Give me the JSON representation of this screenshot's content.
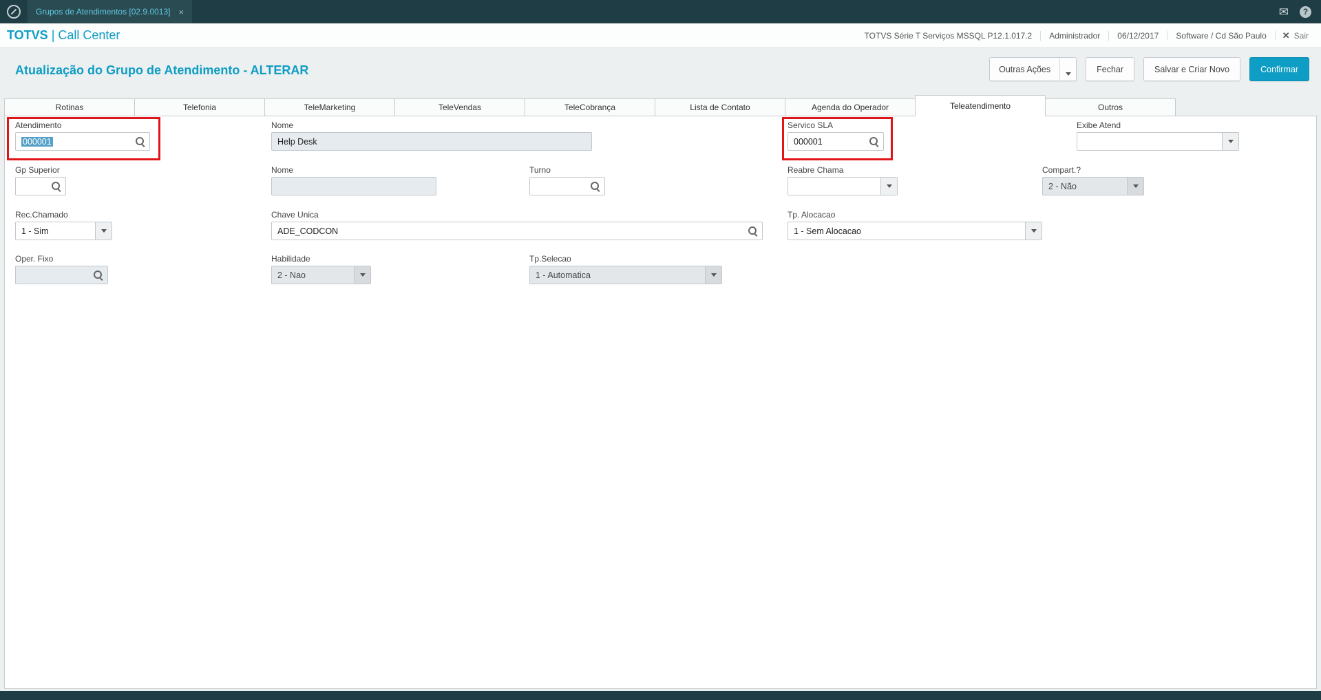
{
  "colors": {
    "accent": "#0e9dc4",
    "topbar_bg": "#1e3d44",
    "annotation_red": "#e01518",
    "readonly_bg": "#e6ebef",
    "selection_bg": "#55a0c8"
  },
  "topbar": {
    "tab_label": "Grupos de Atendimentos [02.9.0013]",
    "tab_close": "×",
    "help_glyph": "?",
    "mail_glyph": "✉"
  },
  "header": {
    "brand_bold": "TOTVS",
    "brand_rest": " | Call Center",
    "items": [
      "TOTVS Série T Serviços MSSQL P12.1.017.2",
      "Administrador",
      "06/12/2017",
      "Software / Cd São Paulo"
    ],
    "logout_x": "✕",
    "logout_label": "Sair"
  },
  "toolbar": {
    "title": "Atualização do Grupo de Atendimento - ALTERAR",
    "buttons": {
      "other_actions": "Outras Ações",
      "close": "Fechar",
      "save_and_new": "Salvar e Criar Novo",
      "confirm": "Confirmar"
    }
  },
  "tabs": [
    "Rotinas",
    "Telefonia",
    "TeleMarketing",
    "TeleVendas",
    "TeleCobrança",
    "Lista de Contato",
    "Agenda do Operador",
    "Teleatendimento",
    "Outros"
  ],
  "active_tab": "Teleatendimento",
  "form": {
    "atendimento": {
      "label": "Atendimento",
      "value": "000001"
    },
    "nome_grupo": {
      "label": "Nome",
      "value": "Help Desk"
    },
    "servico_sla": {
      "label": "Servico SLA",
      "value": "000001"
    },
    "exibe_atend": {
      "label": "Exibe Atend",
      "value": ""
    },
    "gp_superior": {
      "label": "Gp Superior",
      "value": ""
    },
    "nome_superior": {
      "label": "Nome",
      "value": ""
    },
    "turno": {
      "label": "Turno",
      "value": ""
    },
    "reabre_chama": {
      "label": "Reabre Chama",
      "value": ""
    },
    "compart": {
      "label": "Compart.?",
      "value": "2 - Não"
    },
    "rec_chamado": {
      "label": "Rec.Chamado",
      "value": "1 - Sim"
    },
    "chave_unica": {
      "label": "Chave Unica",
      "value": "ADE_CODCON"
    },
    "tp_alocacao": {
      "label": "Tp. Alocacao",
      "value": "1 - Sem Alocacao"
    },
    "oper_fixo": {
      "label": "Oper. Fixo",
      "value": ""
    },
    "habilidade": {
      "label": "Habilidade",
      "value": "2 - Nao"
    },
    "tp_selecao": {
      "label": "Tp.Selecao",
      "value": "1 - Automatica"
    }
  }
}
